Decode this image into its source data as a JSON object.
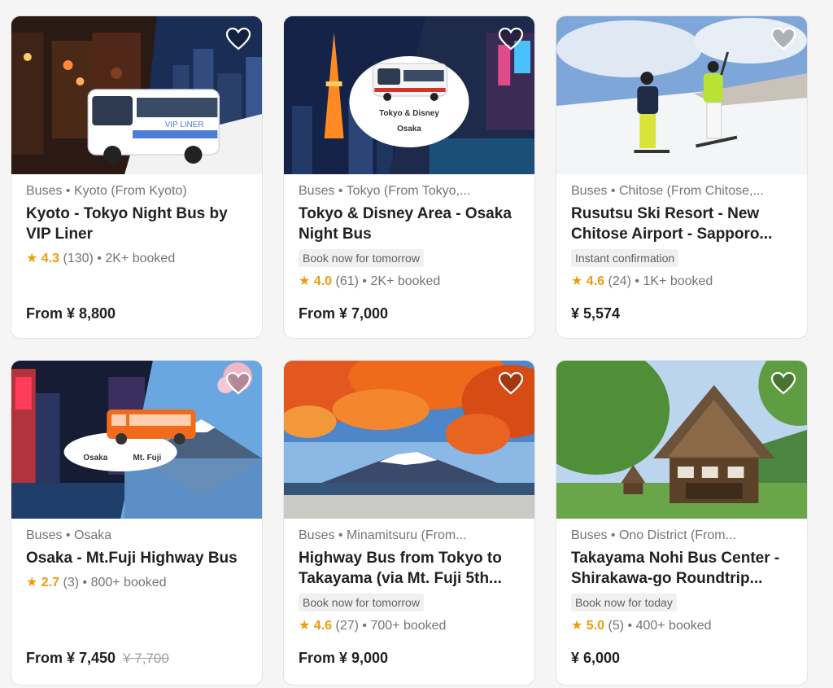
{
  "cards": [
    {
      "category": "Buses • Kyoto (From Kyoto)",
      "title": "Kyoto - Tokyo Night Bus by VIP Liner",
      "tag": "",
      "rating": "4.3",
      "reviews": "(130)",
      "booked": "• 2K+ booked",
      "price": "From ¥ 8,800",
      "old_price": "",
      "image_text": "VIP LINER"
    },
    {
      "category": "Buses • Tokyo (From Tokyo,...",
      "title": "Tokyo & Disney Area - Osaka Night Bus",
      "tag": "Book now for tomorrow",
      "rating": "4.0",
      "reviews": "(61)",
      "booked": "• 2K+ booked",
      "price": "From ¥ 7,000",
      "old_price": "",
      "image_text": "Tokyo & Disney",
      "image_text2": "Osaka"
    },
    {
      "category": "Buses • Chitose (From Chitose,...",
      "title": "Rusutsu Ski Resort - New Chitose Airport - Sapporo...",
      "tag": "Instant confirmation",
      "rating": "4.6",
      "reviews": "(24)",
      "booked": "• 1K+ booked",
      "price": "¥ 5,574",
      "old_price": ""
    },
    {
      "category": "Buses • Osaka",
      "title": "Osaka - Mt.Fuji Highway Bus",
      "tag": "",
      "rating": "2.7",
      "reviews": "(3)",
      "booked": "• 800+ booked",
      "price": "From ¥ 7,450",
      "old_price": "¥ 7,700",
      "image_text": "Osaka",
      "image_text2": "Mt. Fuji"
    },
    {
      "category": "Buses • Minamitsuru (From...",
      "title": "Highway Bus from Tokyo to Takayama (via Mt. Fuji 5th...",
      "tag": "Book now for tomorrow",
      "rating": "4.6",
      "reviews": "(27)",
      "booked": "• 700+ booked",
      "price": "From ¥ 9,000",
      "old_price": ""
    },
    {
      "category": "Buses • Ono District (From...",
      "title": "Takayama Nohi Bus Center - Shirakawa-go Roundtrip...",
      "tag": "Book now for today",
      "rating": "5.0",
      "reviews": "(5)",
      "booked": "• 400+ booked",
      "price": "¥ 6,000",
      "old_price": ""
    }
  ],
  "icons": {
    "wishlist": "heart-icon",
    "rating": "star-icon"
  },
  "colors": {
    "rating": "#f09b0a",
    "bus_orange": "#f26b1d"
  }
}
